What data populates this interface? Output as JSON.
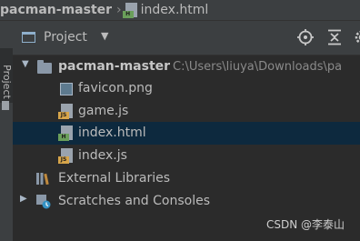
{
  "breadcrumb": {
    "project": "pacman-master",
    "separator": "›",
    "file": "index.html"
  },
  "sidestrip": {
    "label": "Project"
  },
  "toolbar": {
    "title": "Project",
    "icons": [
      "locate-icon",
      "collapse-all-icon",
      "gear-icon"
    ]
  },
  "tree": {
    "root": {
      "name": "pacman-master",
      "path": "C:\\Users\\liuya\\Downloads\\pa"
    },
    "files": [
      {
        "name": "favicon.png",
        "type": "image"
      },
      {
        "name": "game.js",
        "type": "js"
      },
      {
        "name": "index.html",
        "type": "html",
        "selected": true
      },
      {
        "name": "index.js",
        "type": "js"
      }
    ],
    "external_libraries": "External Libraries",
    "scratches": "Scratches and Consoles"
  },
  "colors": {
    "selection": "#0d293e",
    "js_badge": "#d7a54a",
    "html_badge": "#6a9f5a"
  },
  "watermark": "CSDN @李泰山"
}
